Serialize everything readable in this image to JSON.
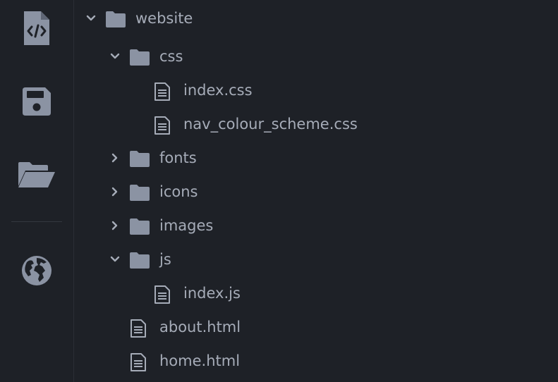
{
  "activity_bar": {
    "items": [
      {
        "name": "code-file-icon"
      },
      {
        "name": "save-icon"
      },
      {
        "name": "open-folder-icon"
      },
      {
        "name": "globe-icon"
      }
    ]
  },
  "tree": {
    "items": [
      {
        "label": "website",
        "type": "folder",
        "expanded": true
      },
      {
        "label": "css",
        "type": "folder",
        "expanded": true
      },
      {
        "label": "index.css",
        "type": "file"
      },
      {
        "label": "nav_colour_scheme.css",
        "type": "file"
      },
      {
        "label": "fonts",
        "type": "folder",
        "expanded": false
      },
      {
        "label": "icons",
        "type": "folder",
        "expanded": false
      },
      {
        "label": "images",
        "type": "folder",
        "expanded": false
      },
      {
        "label": "js",
        "type": "folder",
        "expanded": true
      },
      {
        "label": "index.js",
        "type": "file"
      },
      {
        "label": "about.html",
        "type": "file"
      },
      {
        "label": "home.html",
        "type": "file"
      }
    ]
  },
  "colors": {
    "background": "#1e2127",
    "text": "#a6acb8",
    "icon": "#8b93a3"
  }
}
